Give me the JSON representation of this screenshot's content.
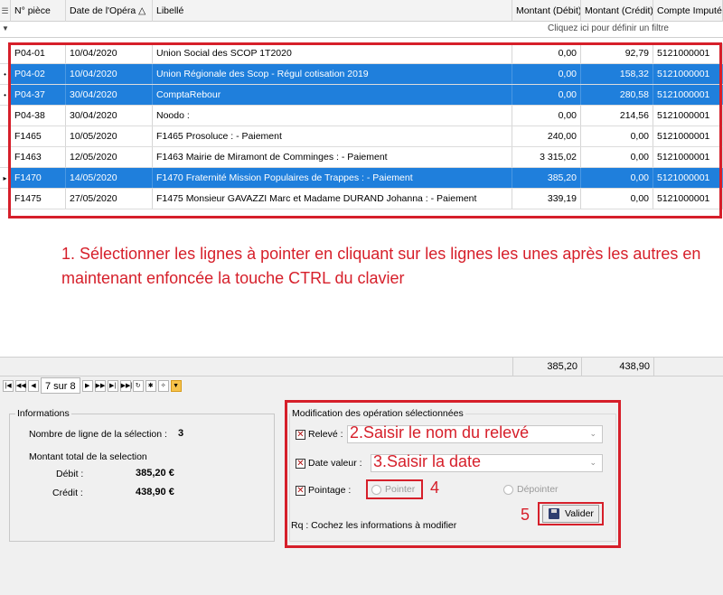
{
  "columns": [
    "N° pièce",
    "Date de l'Opéra",
    "Libellé",
    "Montant (Débit)",
    "Montant (Crédit)",
    "Compte Imputé"
  ],
  "sort_indicator": "△",
  "filter_hint": "Cliquez ici pour définir un filtre",
  "rows": [
    {
      "piece": "P04-01",
      "date": "10/04/2020",
      "libelle": "Union Social des SCOP 1T2020",
      "debit": "0,00",
      "credit": "92,79",
      "compte": "5121000001",
      "selected": false
    },
    {
      "piece": "P04-02",
      "date": "10/04/2020",
      "libelle": "Union Régionale des Scop - Régul cotisation 2019",
      "debit": "0,00",
      "credit": "158,32",
      "compte": "5121000001",
      "selected": true
    },
    {
      "piece": "P04-37",
      "date": "30/04/2020",
      "libelle": "ComptaRebour",
      "debit": "0,00",
      "credit": "280,58",
      "compte": "5121000001",
      "selected": true
    },
    {
      "piece": "P04-38",
      "date": "30/04/2020",
      "libelle": "Noodo :",
      "debit": "0,00",
      "credit": "214,56",
      "compte": "5121000001",
      "selected": false
    },
    {
      "piece": "F1465",
      "date": "10/05/2020",
      "libelle": "F1465 Prosoluce : - Paiement",
      "debit": "240,00",
      "credit": "0,00",
      "compte": "5121000001",
      "selected": false
    },
    {
      "piece": "F1463",
      "date": "12/05/2020",
      "libelle": "F1463 Mairie de Miramont de Comminges : - Paiement",
      "debit": "3 315,02",
      "credit": "0,00",
      "compte": "5121000001",
      "selected": false
    },
    {
      "piece": "F1470",
      "date": "14/05/2020",
      "libelle": "F1470 Fraternité Mission Populaires de Trappes : - Paiement",
      "debit": "385,20",
      "credit": "0,00",
      "compte": "5121000001",
      "selected": true
    },
    {
      "piece": "F1475",
      "date": "27/05/2020",
      "libelle": "F1475 Monsieur GAVAZZI Marc et Madame DURAND Johanna : - Paiement",
      "debit": "339,19",
      "credit": "0,00",
      "compte": "5121000001",
      "selected": false
    }
  ],
  "instruction": "1. Sélectionner les lignes à pointer en cliquant sur les lignes les unes après les autres en maintenant enfoncée la touche CTRL du clavier",
  "totals": {
    "debit": "385,20",
    "credit": "438,90"
  },
  "pager": "7 sur 8",
  "info": {
    "legend": "Informations",
    "nb_label": "Nombre de ligne de la sélection :",
    "nb_value": "3",
    "total_label": "Montant total de la selection",
    "debit_label": "Débit :",
    "debit_value": "385,20 €",
    "credit_label": "Crédit :",
    "credit_value": "438,90 €"
  },
  "modif": {
    "legend": "Modification des opération sélectionnées",
    "releve_label": "Relevé :",
    "releve_note": "2.Saisir le nom du relevé",
    "date_label": "Date valeur :",
    "date_note": "3.Saisir la date",
    "pointage_label": "Pointage :",
    "pointer_label": "Pointer",
    "step4": "4",
    "depointer_label": "Dépointer",
    "step5": "5",
    "valider_label": "Valider",
    "note": "Rq : Cochez les informations à modifier"
  },
  "colors": {
    "selection": "#1f7fdc",
    "annotation": "#d61f2a"
  }
}
